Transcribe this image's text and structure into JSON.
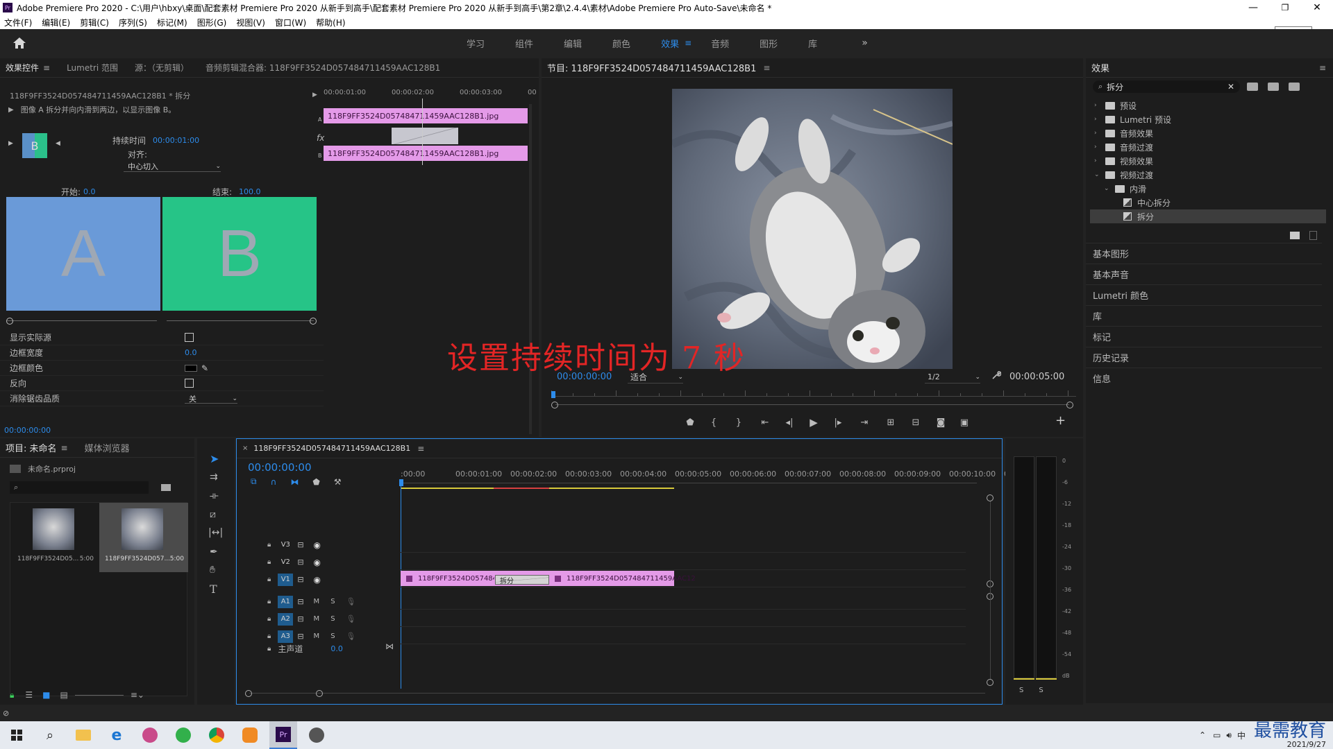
{
  "titlebar": {
    "title": "Adobe Premiere Pro 2020 - C:\\用户\\hbxy\\桌面\\配套素材 Premiere Pro 2020 从新手到高手\\配套素材 Premiere Pro 2020 从新手到高手\\第2章\\2.4.4\\素材\\Adobe Premiere Pro Auto-Save\\未命名 *",
    "tooltip": "向下还原"
  },
  "menubar": {
    "items": [
      "文件(F)",
      "编辑(E)",
      "剪辑(C)",
      "序列(S)",
      "标记(M)",
      "图形(G)",
      "视图(V)",
      "窗口(W)",
      "帮助(H)"
    ]
  },
  "workspace": {
    "tabs": [
      "学习",
      "组件",
      "编辑",
      "颜色",
      "效果",
      "音频",
      "图形",
      "库"
    ],
    "active": "效果",
    "more": "»"
  },
  "effect_controls": {
    "tabs": [
      "效果控件",
      "Lumetri 范围",
      "源：（无剪辑）",
      "音频剪辑混合器: 118F9FF3524D057484711459AAC128B1"
    ],
    "clip_header": "118F9FF3524D057484711459AAC128B1 * 拆分",
    "description": "图像 A 拆分并向内滑到两边，以显示图像 B。",
    "duration_label": "持续时间",
    "duration_value": "00:00:01:00",
    "alignment_label": "对齐:",
    "alignment_value": "中心切入",
    "start_label": "开始:",
    "start_value": "0.0",
    "end_label": "结束:",
    "end_value": "100.0",
    "preview_a": "A",
    "preview_b": "B",
    "thumb_label": "B",
    "props": [
      {
        "label": "显示实际源",
        "type": "checkbox"
      },
      {
        "label": "边框宽度",
        "type": "value",
        "value": "0.0"
      },
      {
        "label": "边框颜色",
        "type": "color"
      },
      {
        "label": "反向",
        "type": "checkbox"
      },
      {
        "label": "消除锯齿品质",
        "type": "select",
        "value": "关"
      }
    ],
    "timecode": "00:00:00:00",
    "mini_ruler": [
      "00:00:01:00",
      "00:00:02:00",
      "00:00:03:00",
      "00"
    ],
    "track_a_label": "A",
    "track_b_label": "B",
    "clip_name": "118F9FF3524D057484711459AAC128B1.jpg",
    "fx_label": "fx"
  },
  "program": {
    "title": "节目: 118F9FF3524D057484711459AAC128B1",
    "timecode": "00:00:00:00",
    "fit": "适合",
    "resolution": "1/2",
    "duration": "00:00:05:00"
  },
  "overlay_caption": "设置持续时间为 7 秒",
  "effects_panel": {
    "title": "效果",
    "search": "拆分",
    "tree": [
      {
        "label": "预设",
        "level": 0,
        "expanded": false
      },
      {
        "label": "Lumetri 预设",
        "level": 0,
        "expanded": false
      },
      {
        "label": "音频效果",
        "level": 0,
        "expanded": false
      },
      {
        "label": "音频过渡",
        "level": 0,
        "expanded": false
      },
      {
        "label": "视频效果",
        "level": 0,
        "expanded": false
      },
      {
        "label": "视频过渡",
        "level": 0,
        "expanded": true
      },
      {
        "label": "内滑",
        "level": 1,
        "expanded": true
      },
      {
        "label": "中心拆分",
        "level": 2,
        "expanded": false
      },
      {
        "label": "拆分",
        "level": 2,
        "expanded": false
      }
    ],
    "selected": "拆分",
    "side_panels": [
      "基本图形",
      "基本声音",
      "Lumetri 颜色",
      "库",
      "标记",
      "历史记录",
      "信息"
    ]
  },
  "project": {
    "tabs": [
      "项目: 未命名",
      "媒体浏览器"
    ],
    "file": "未命名.prproj",
    "items": [
      {
        "name": "118F9FF3524D05...",
        "duration": "5:00"
      },
      {
        "name": "118F9FF3524D057...",
        "duration": "5:00"
      }
    ]
  },
  "timeline": {
    "tab": "118F9FF3524D057484711459AAC128B1",
    "timecode": "00:00:00:00",
    "ruler": [
      ":00:00",
      "00:00:01:00",
      "00:00:02:00",
      "00:00:03:00",
      "00:00:04:00",
      "00:00:05:00",
      "00:00:06:00",
      "00:00:07:00",
      "00:00:08:00",
      "00:00:09:00",
      "00:00:10:00",
      "0"
    ],
    "tracks": [
      {
        "name": "V3",
        "kind": "video",
        "on": false
      },
      {
        "name": "V2",
        "kind": "video",
        "on": false
      },
      {
        "name": "V1",
        "kind": "video",
        "on": true
      },
      {
        "name": "A1",
        "kind": "audio",
        "on": true
      },
      {
        "name": "A2",
        "kind": "audio",
        "on": true
      },
      {
        "name": "A3",
        "kind": "audio",
        "on": true
      }
    ],
    "master_label": "主声道",
    "master_value": "0.0",
    "m_label": "M",
    "s_label": "S",
    "clip1": "118F9FF3524D0574847",
    "transition": "拆分",
    "clip2": "118F9FF3524D057484711459AAC12"
  },
  "audio_meter": {
    "scale": [
      "0",
      "-6",
      "-12",
      "-18",
      "-24",
      "-30",
      "-36",
      "-42",
      "-48",
      "-54",
      "dB"
    ],
    "solo": [
      "S",
      "S"
    ]
  },
  "taskbar": {
    "ime": "中",
    "brand": "最需教育",
    "date": "2021/9/27"
  }
}
